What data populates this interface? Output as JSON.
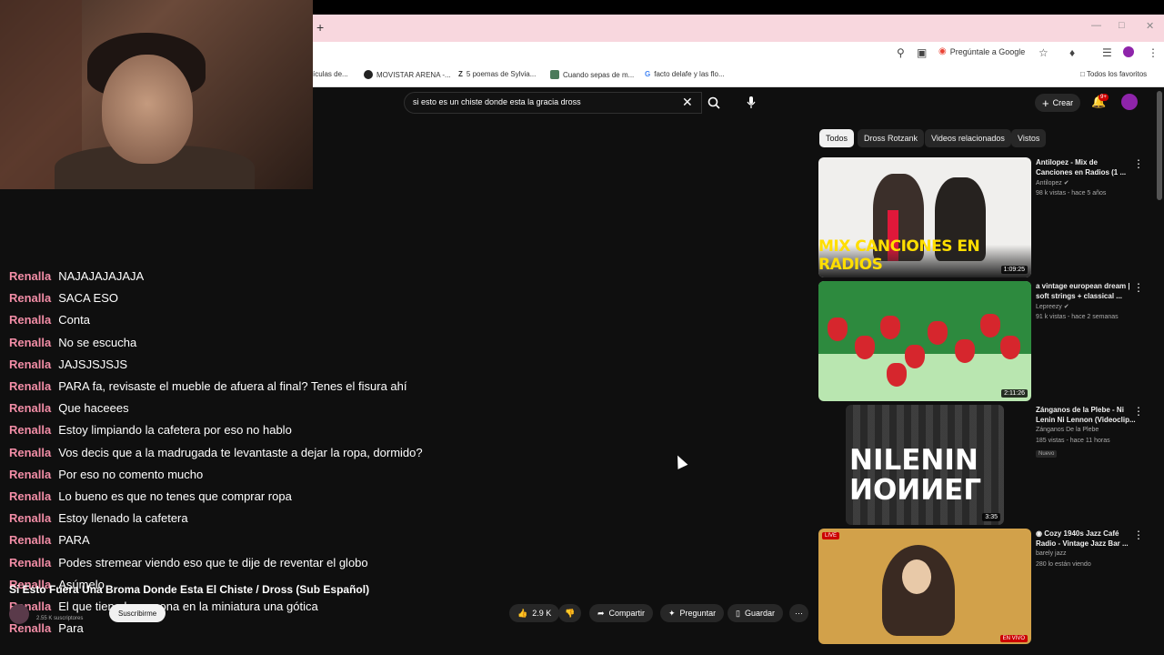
{
  "browser": {
    "new_tab": "+",
    "ask_google": "Pregúntale a Google",
    "bookmarks": [
      "ículas de...",
      "MOVISTAR ARENA -...",
      "5 poemas de Sylvia...",
      "Cuando sepas de m...",
      "facto delafe y las flo..."
    ],
    "all_favorites": "Todos los favoritos"
  },
  "youtube": {
    "search_value": "si esto es un chiste donde esta la gracia dross",
    "create_label": "Crear",
    "notifications_badge": "9+",
    "chips": [
      "Todos",
      "Dross Rotzank",
      "Videos relacionados",
      "Vistos"
    ]
  },
  "chat": [
    {
      "user": "Renalla",
      "msg": "NAJAJAJAJAJA"
    },
    {
      "user": "Renalla",
      "msg": "SACA ESO"
    },
    {
      "user": "Renalla",
      "msg": "Conta"
    },
    {
      "user": "Renalla",
      "msg": "No se escucha"
    },
    {
      "user": "Renalla",
      "msg": "JAJSJSJSJS"
    },
    {
      "user": "Renalla",
      "msg": "PARA fa, revisaste el mueble de afuera al final? Tenes el fisura ahí"
    },
    {
      "user": "Renalla",
      "msg": "Que haceees"
    },
    {
      "user": "Renalla",
      "msg": "Estoy limpiando la cafetera por eso no hablo"
    },
    {
      "user": "Renalla",
      "msg": "Vos decis que a la madrugada te levantaste a dejar la ropa, dormido?"
    },
    {
      "user": "Renalla",
      "msg": "Por eso no comento mucho"
    },
    {
      "user": "Renalla",
      "msg": "Lo bueno es que no tenes que comprar ropa"
    },
    {
      "user": "Renalla",
      "msg": "Estoy llenado la cafetera"
    },
    {
      "user": "Renalla",
      "msg": "PARA"
    },
    {
      "user": "Renalla",
      "msg": "Podes stremear viendo eso que te dije de reventar el globo"
    },
    {
      "user": "Renalla",
      "msg": "Asúmelo"
    },
    {
      "user": "Renalla",
      "msg": "El que tiene la persona en la miniatura una gótica"
    },
    {
      "user": "Renalla",
      "msg": "Para"
    }
  ],
  "video": {
    "title": "Si Esto Fuera Una Broma Donde Esta El Chiste / Dross (Sub Español)",
    "channel_subs": "2.55 K suscriptores",
    "subscribe_label": "Suscribirme",
    "likes": "2.9 K",
    "share_label": "Compartir",
    "ask_label": "Preguntar",
    "save_label": "Guardar"
  },
  "recommendations": [
    {
      "title": "Antilopez - Mix de Canciones en Radios (1 ...",
      "channel": "Antilopez",
      "meta": "98 k vistas - hace 5 años",
      "duration": "1:09:25",
      "thumb_caption": "MIX CANCIONES EN RADIOS"
    },
    {
      "title": "a vintage european dream | soft strings + classical ...",
      "channel": "Lepreezy",
      "meta": "91 k vistas - hace 2 semanas",
      "duration": "2:11:26"
    },
    {
      "title": "Zánganos de la Plebe - Ni Lenin Ni Lennon (Videoclip...",
      "channel": "Zánganos De la Plebe",
      "meta": "185 vistas - hace 11 horas",
      "badge": "Nuevo",
      "duration": "3:35",
      "thumb_caption_top": "NILENIN",
      "thumb_caption_bottom": "NONNEL"
    },
    {
      "title": "Cozy 1940s Jazz Café Radio - Vintage Jazz Bar ...",
      "channel": "barely jazz",
      "meta": "280 lo están viendo",
      "live_tag": "LIVE",
      "live_tag_bottom": "EN VIVO"
    }
  ],
  "colors": {
    "chat_user": "#f28da6",
    "yt_bg": "#0f0f0f",
    "tabstrip": "#f8d7de"
  }
}
